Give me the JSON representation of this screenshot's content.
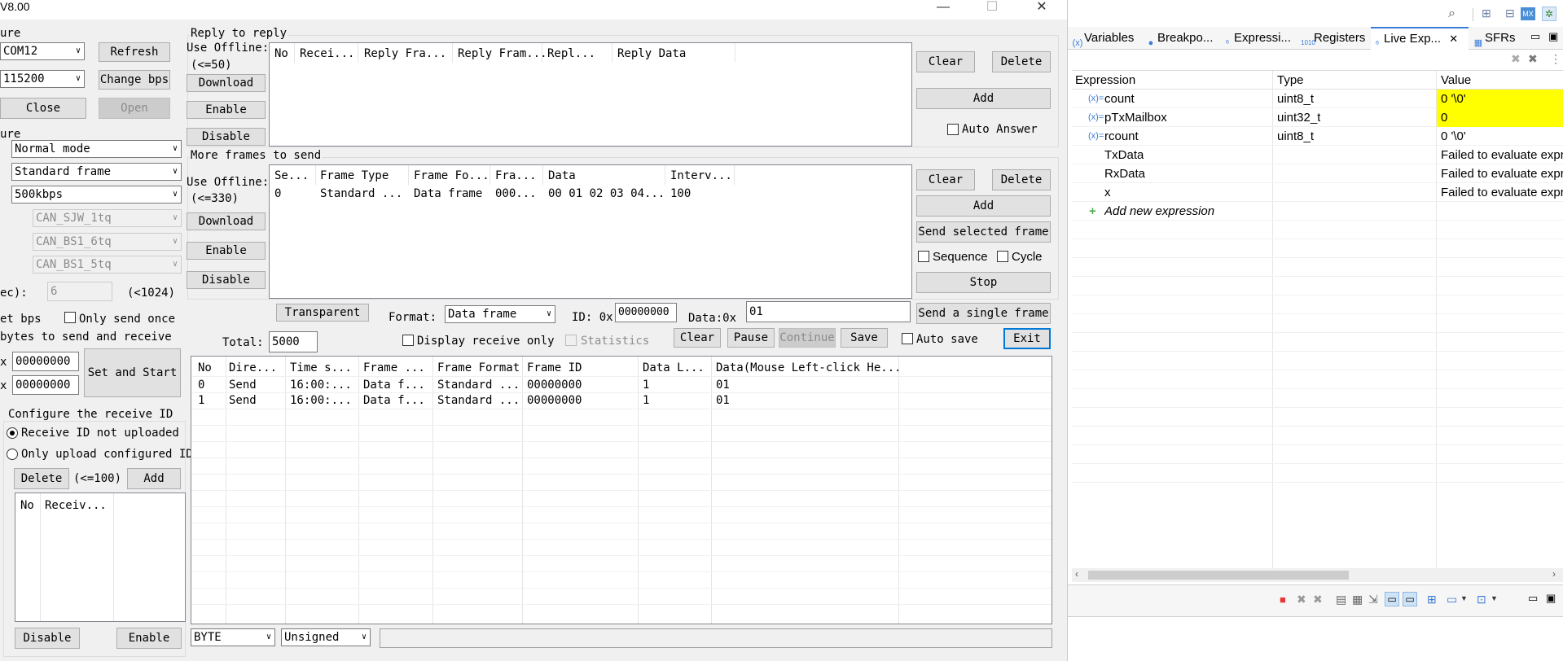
{
  "window": {
    "title": "V8.00",
    "minimize": "—",
    "maximize": "☐",
    "close": "✕"
  },
  "left_panel": {
    "section1_label": "ure",
    "port_value": "COM12",
    "refresh_label": "Refresh",
    "baud_value": "115200",
    "change_bps_label": "Change bps",
    "close_label": "Close",
    "open_label": "Open",
    "section2_label": "ure",
    "mode_value": "Normal mode",
    "frame_value": "Standard frame",
    "rate_value": "500kbps",
    "sjw_value": "CAN_SJW_1tq",
    "bs1_value": "CAN_BS1_6tq",
    "bs2_value": "CAN_BS1_5tq",
    "ec_label": "ec):",
    "ec_value": "6",
    "ec_hint": "(<1024)",
    "set_bps_label": "et bps",
    "only_send_once_label": "Only send once",
    "bytes_label": "bytes to send and receive",
    "x1_label": "x",
    "x1_value": "00000000",
    "x2_label": "x",
    "x2_value": "00000000",
    "set_start_label": "Set and Start",
    "receive_id_group": "Configure the receive ID",
    "radio_not_uploaded": "Receive ID not uploaded",
    "radio_only_configured": "Only upload configured ID",
    "delete_label": "Delete",
    "limit_label": "(<=100)",
    "add_label": "Add",
    "id_list_headers": [
      "No",
      "Receiv..."
    ],
    "disable_label": "Disable",
    "enable_label": "Enable"
  },
  "reply": {
    "title": "Reply to reply",
    "use_offline": "Use Offline:",
    "limit": "(<=50)",
    "download": "Download",
    "enable": "Enable",
    "disable": "Disable",
    "headers": [
      "No",
      "Recei...",
      "Reply Fra...",
      "Reply Fram...",
      "Repl...",
      "Reply Data"
    ],
    "clear": "Clear",
    "delete": "Delete",
    "add": "Add",
    "auto_answer": "Auto Answer"
  },
  "more": {
    "title": "More frames to send",
    "use_offline": "Use Offline:",
    "limit": "(<=330)",
    "download": "Download",
    "enable": "Enable",
    "disable": "Disable",
    "headers": [
      "Se...",
      "Frame Type",
      "Frame Fo...",
      "Fra...",
      "Data",
      "Interv..."
    ],
    "rows": [
      [
        "0",
        "Standard ...",
        "Data frame",
        "000...",
        "00 01 02 03 04...",
        "100"
      ]
    ],
    "clear": "Clear",
    "delete": "Delete",
    "add": "Add",
    "send_selected": "Send selected frame",
    "sequence": "Sequence",
    "cycle": "Cycle",
    "stop": "Stop"
  },
  "send_bar": {
    "transparent": "Transparent",
    "format_label": "Format:",
    "format_value": "Data frame",
    "id_label": "ID: 0x",
    "id_value": "00000000",
    "data_label": "Data:0x",
    "data_value": "01",
    "send_single": "Send a single frame"
  },
  "recv_bar": {
    "total_label": "Total:",
    "total_value": "5000",
    "display_receive_only": "Display receive only",
    "statistics": "Statistics",
    "clear": "Clear",
    "pause": "Pause",
    "continue": "Continue",
    "save": "Save",
    "auto_save": "Auto save",
    "exit": "Exit"
  },
  "frames": {
    "headers": [
      "No",
      "Dire...",
      "Time s...",
      "Frame ...",
      "Frame Format",
      "Frame ID",
      "Data L...",
      "Data(Mouse Left-click He..."
    ],
    "rows": [
      [
        "0",
        "Send",
        "16:00:...",
        "Data f...",
        "Standard ...",
        "00000000",
        "1",
        "01"
      ],
      [
        "1",
        "Send",
        "16:00:...",
        "Data f...",
        "Standard ...",
        "00000000",
        "1",
        "01"
      ]
    ]
  },
  "bottom": {
    "byte_value": "BYTE",
    "sign_value": "Unsigned"
  },
  "eclipse": {
    "tabs": [
      "Variables",
      "Breakpo...",
      "Expressi...",
      "Registers",
      "Live Exp...",
      "SFRs"
    ],
    "tab_close": "✕",
    "headers": [
      "Expression",
      "Type",
      "Value"
    ],
    "rows": [
      {
        "expr": "count",
        "type": "uint8_t",
        "value": "0 '\\0'",
        "highlight": true
      },
      {
        "expr": "pTxMailbox",
        "type": "uint32_t",
        "value": "0",
        "highlight": true
      },
      {
        "expr": "rcount",
        "type": "uint8_t",
        "value": "0 '\\0'",
        "highlight": false
      },
      {
        "expr": "TxData",
        "type": "",
        "value": "Failed to evaluate expr",
        "highlight": false
      },
      {
        "expr": "RxData",
        "type": "",
        "value": "Failed to evaluate expr",
        "highlight": false
      },
      {
        "expr": "x",
        "type": "",
        "value": "Failed to evaluate expr",
        "highlight": false
      }
    ],
    "add_new": "Add new expression",
    "highlight_color": "#ffff00"
  }
}
